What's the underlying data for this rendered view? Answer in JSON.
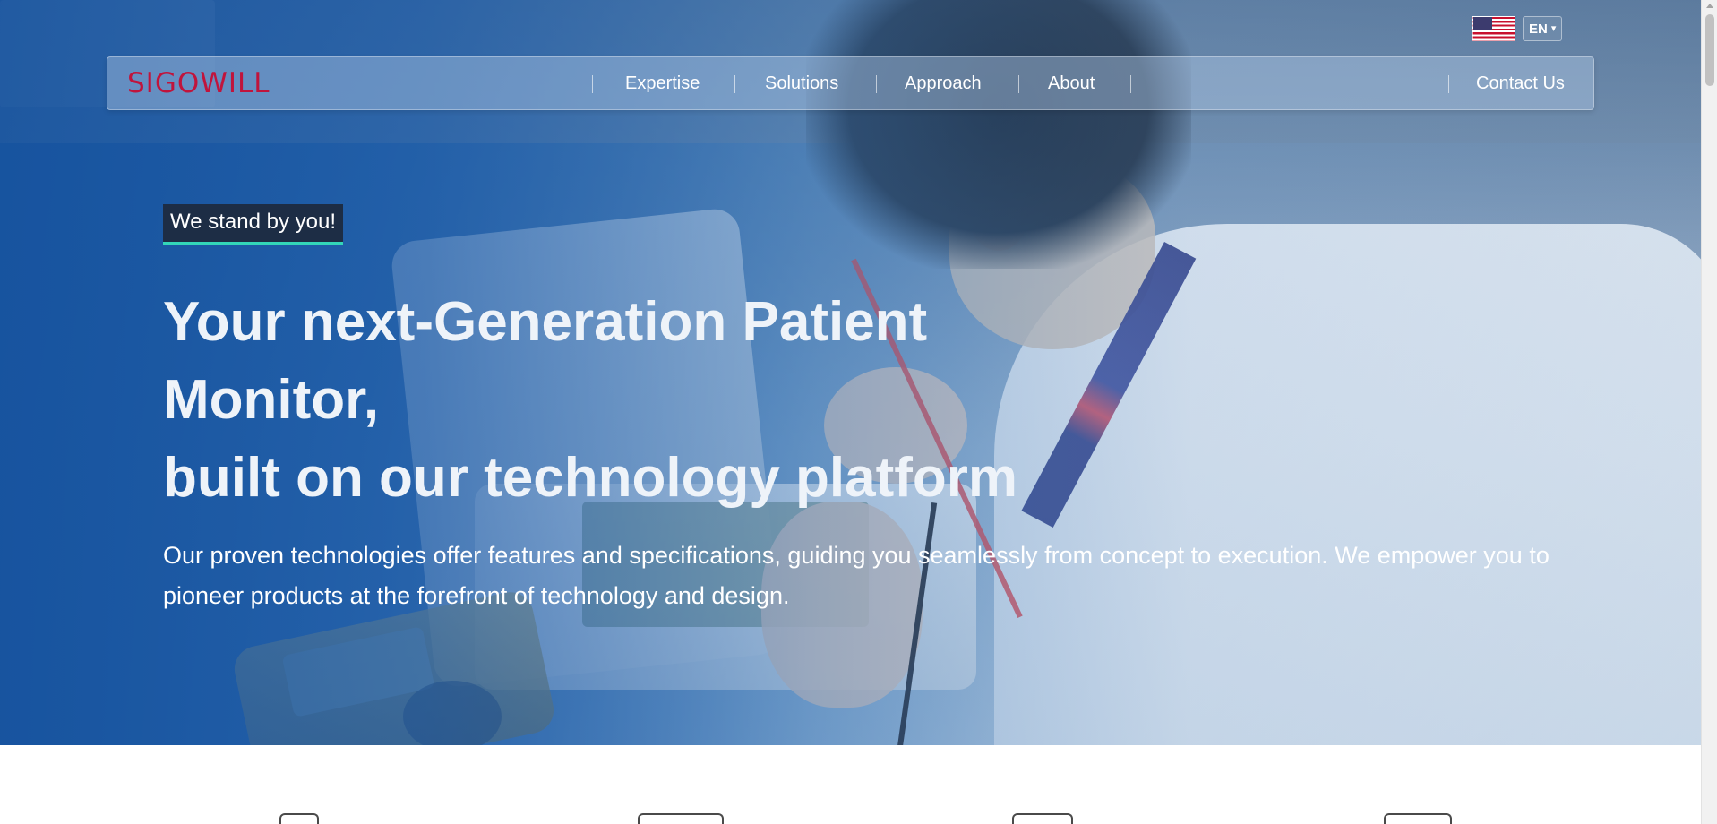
{
  "language": {
    "flag_icon": "us-flag-icon",
    "selected": "EN",
    "chevron_icon": "chevron-down-icon"
  },
  "navbar": {
    "logo_text": "SIGOWILL",
    "logo_color": "#c0143c",
    "items": [
      {
        "label": "Expertise"
      },
      {
        "label": "Solutions"
      },
      {
        "label": "Approach"
      },
      {
        "label": "About"
      }
    ],
    "contact_label": "Contact Us"
  },
  "hero": {
    "tagline": "We stand by you!",
    "tagline_accent": "#33d6b8",
    "headline_line1": "Your next-Generation Patient Monitor,",
    "headline_line2": "built on our technology platform",
    "description": "Our proven technologies offer features and specifications, guiding you seamlessly from concept to execution. We empower you to pioneer products at the forefront of technology and design.",
    "background_image": "engineer-soldering-medical-device-photo"
  },
  "features": {
    "icons": [
      "feature-icon-1",
      "feature-icon-2",
      "feature-icon-3",
      "feature-icon-4"
    ]
  }
}
